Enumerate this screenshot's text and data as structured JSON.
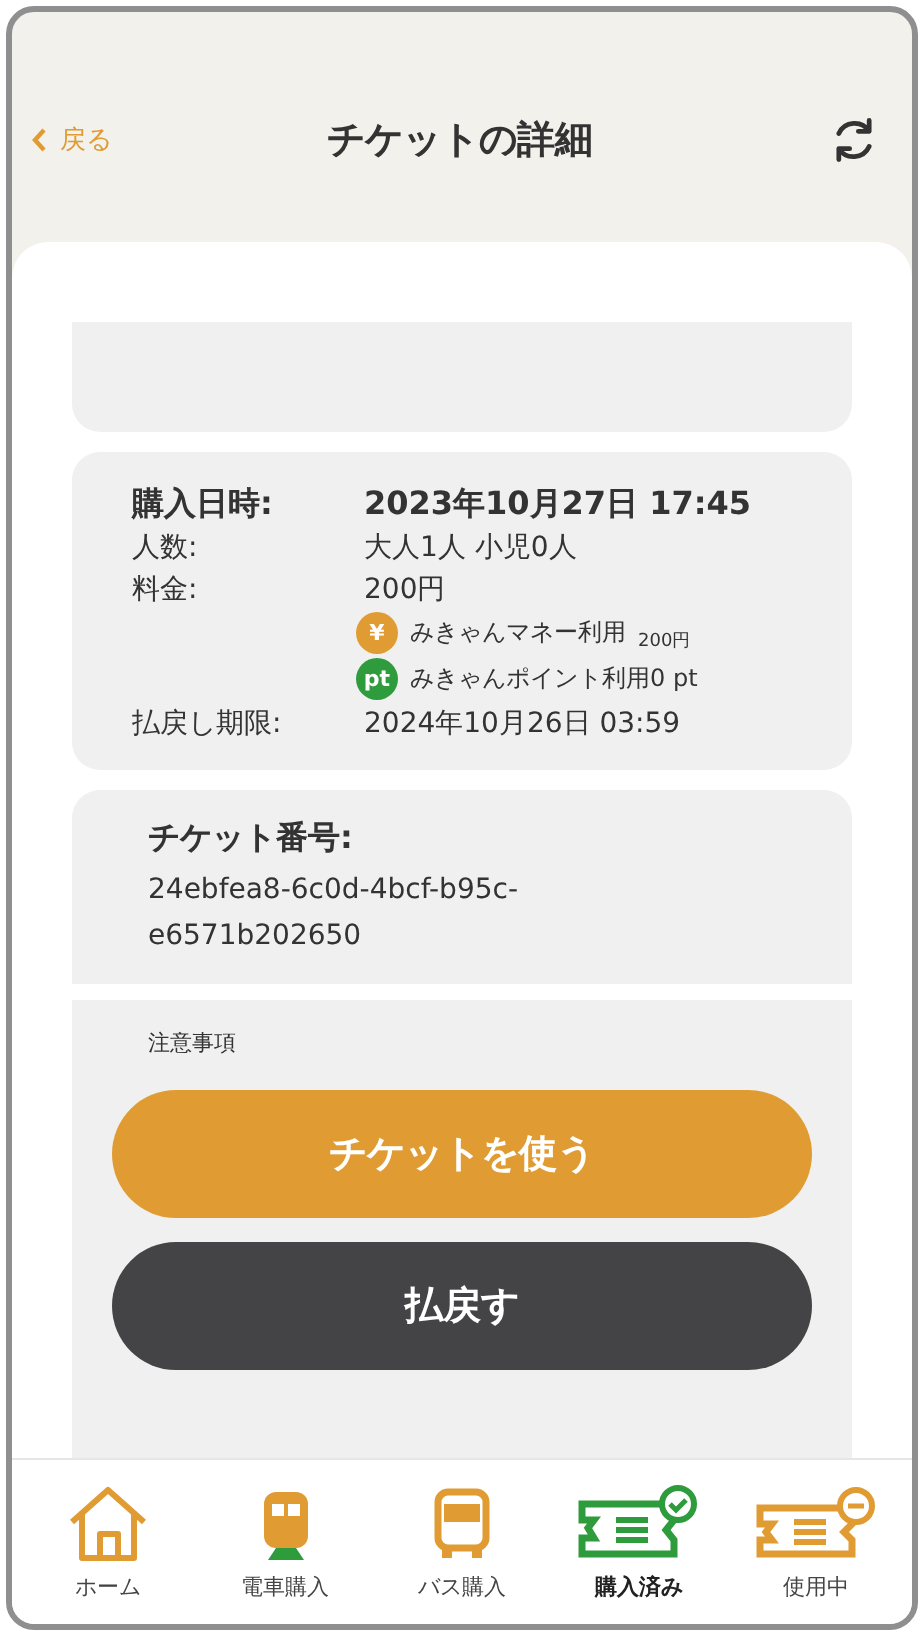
{
  "header": {
    "back": "戻る",
    "title": "チケットの詳細"
  },
  "details": [
    {
      "label": "購入日時:",
      "value": "2023年10月27日 17:45",
      "kind": "main"
    },
    {
      "label": "人数:",
      "value": "大人1人 小児0人",
      "kind": "plain"
    },
    {
      "label": "料金:",
      "value": "200円",
      "kind": "plain"
    },
    {
      "label": "払戻し期限:",
      "value": "2024年10月26日 03:59",
      "kind": "plain"
    }
  ],
  "payments": [
    {
      "kind": "money",
      "badge": "¥",
      "text": "みきゃんマネー利用",
      "amount": "200円"
    },
    {
      "kind": "points",
      "badge": "pt",
      "text": "みきゃんポイント利用0 pt"
    }
  ],
  "ticket": {
    "label": "チケット番号:",
    "number": "24ebfea8-6c0d-4bcf-b95c-e6571b202650"
  },
  "notes_title": "注意事項",
  "buttons": [
    {
      "label": "チケットを使う",
      "kind": "primary"
    },
    {
      "label": "払戻す",
      "kind": "dark"
    }
  ],
  "nav": [
    {
      "label": "ホーム",
      "kind": "home",
      "selected": false
    },
    {
      "label": "電車購入",
      "kind": "train",
      "selected": false
    },
    {
      "label": "バス購入",
      "kind": "bus",
      "selected": false
    },
    {
      "label": "購入済み",
      "kind": "purchased",
      "selected": true
    },
    {
      "label": "使用中",
      "kind": "inuse",
      "selected": false
    }
  ]
}
